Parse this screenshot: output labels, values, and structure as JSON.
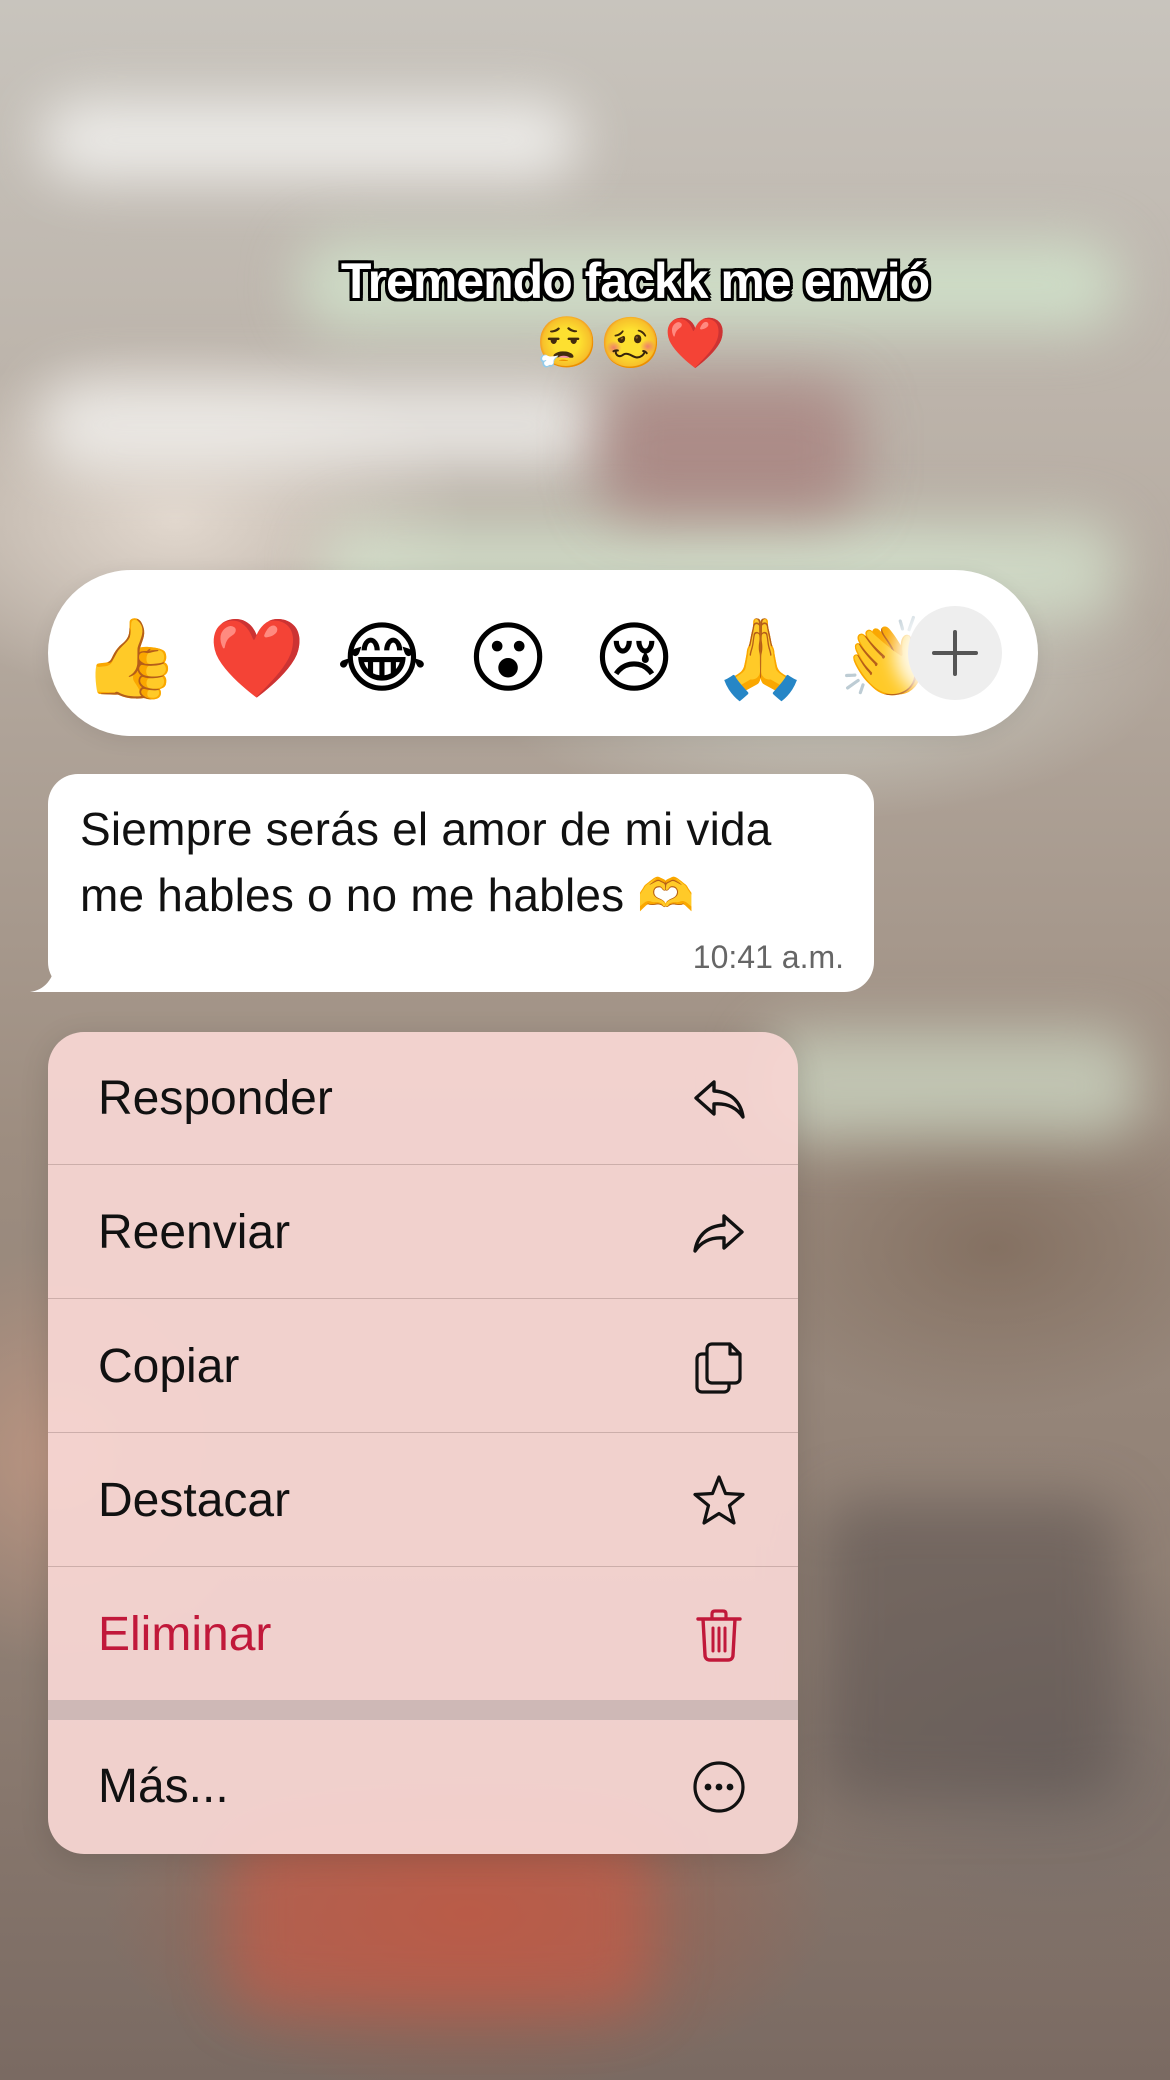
{
  "caption": {
    "text": "Tremendo fackk me envió",
    "emojis": "😮‍💨🥴❤️"
  },
  "reactions": [
    {
      "emoji": "👍",
      "name": "thumbs-up"
    },
    {
      "emoji": "❤️",
      "name": "heart"
    },
    {
      "emoji": "😂",
      "name": "laughing"
    },
    {
      "emoji": "😮",
      "name": "surprised"
    },
    {
      "emoji": "😢",
      "name": "crying"
    },
    {
      "emoji": "🙏",
      "name": "praying"
    },
    {
      "emoji": "👏",
      "name": "clapping"
    }
  ],
  "plus_icon": "plus-icon",
  "message": {
    "line1": "Siempre serás el amor de mi vida",
    "line2": "me hables o no me hables 🫶",
    "time": "10:41 a.m."
  },
  "menu": {
    "reply": "Responder",
    "forward": "Reenviar",
    "copy": "Copiar",
    "star": "Destacar",
    "delete": "Eliminar",
    "more": "Más..."
  },
  "colors": {
    "danger": "#c1183a",
    "menu_bg": "#f6d6d2",
    "bubble_bg": "#ffffff"
  }
}
